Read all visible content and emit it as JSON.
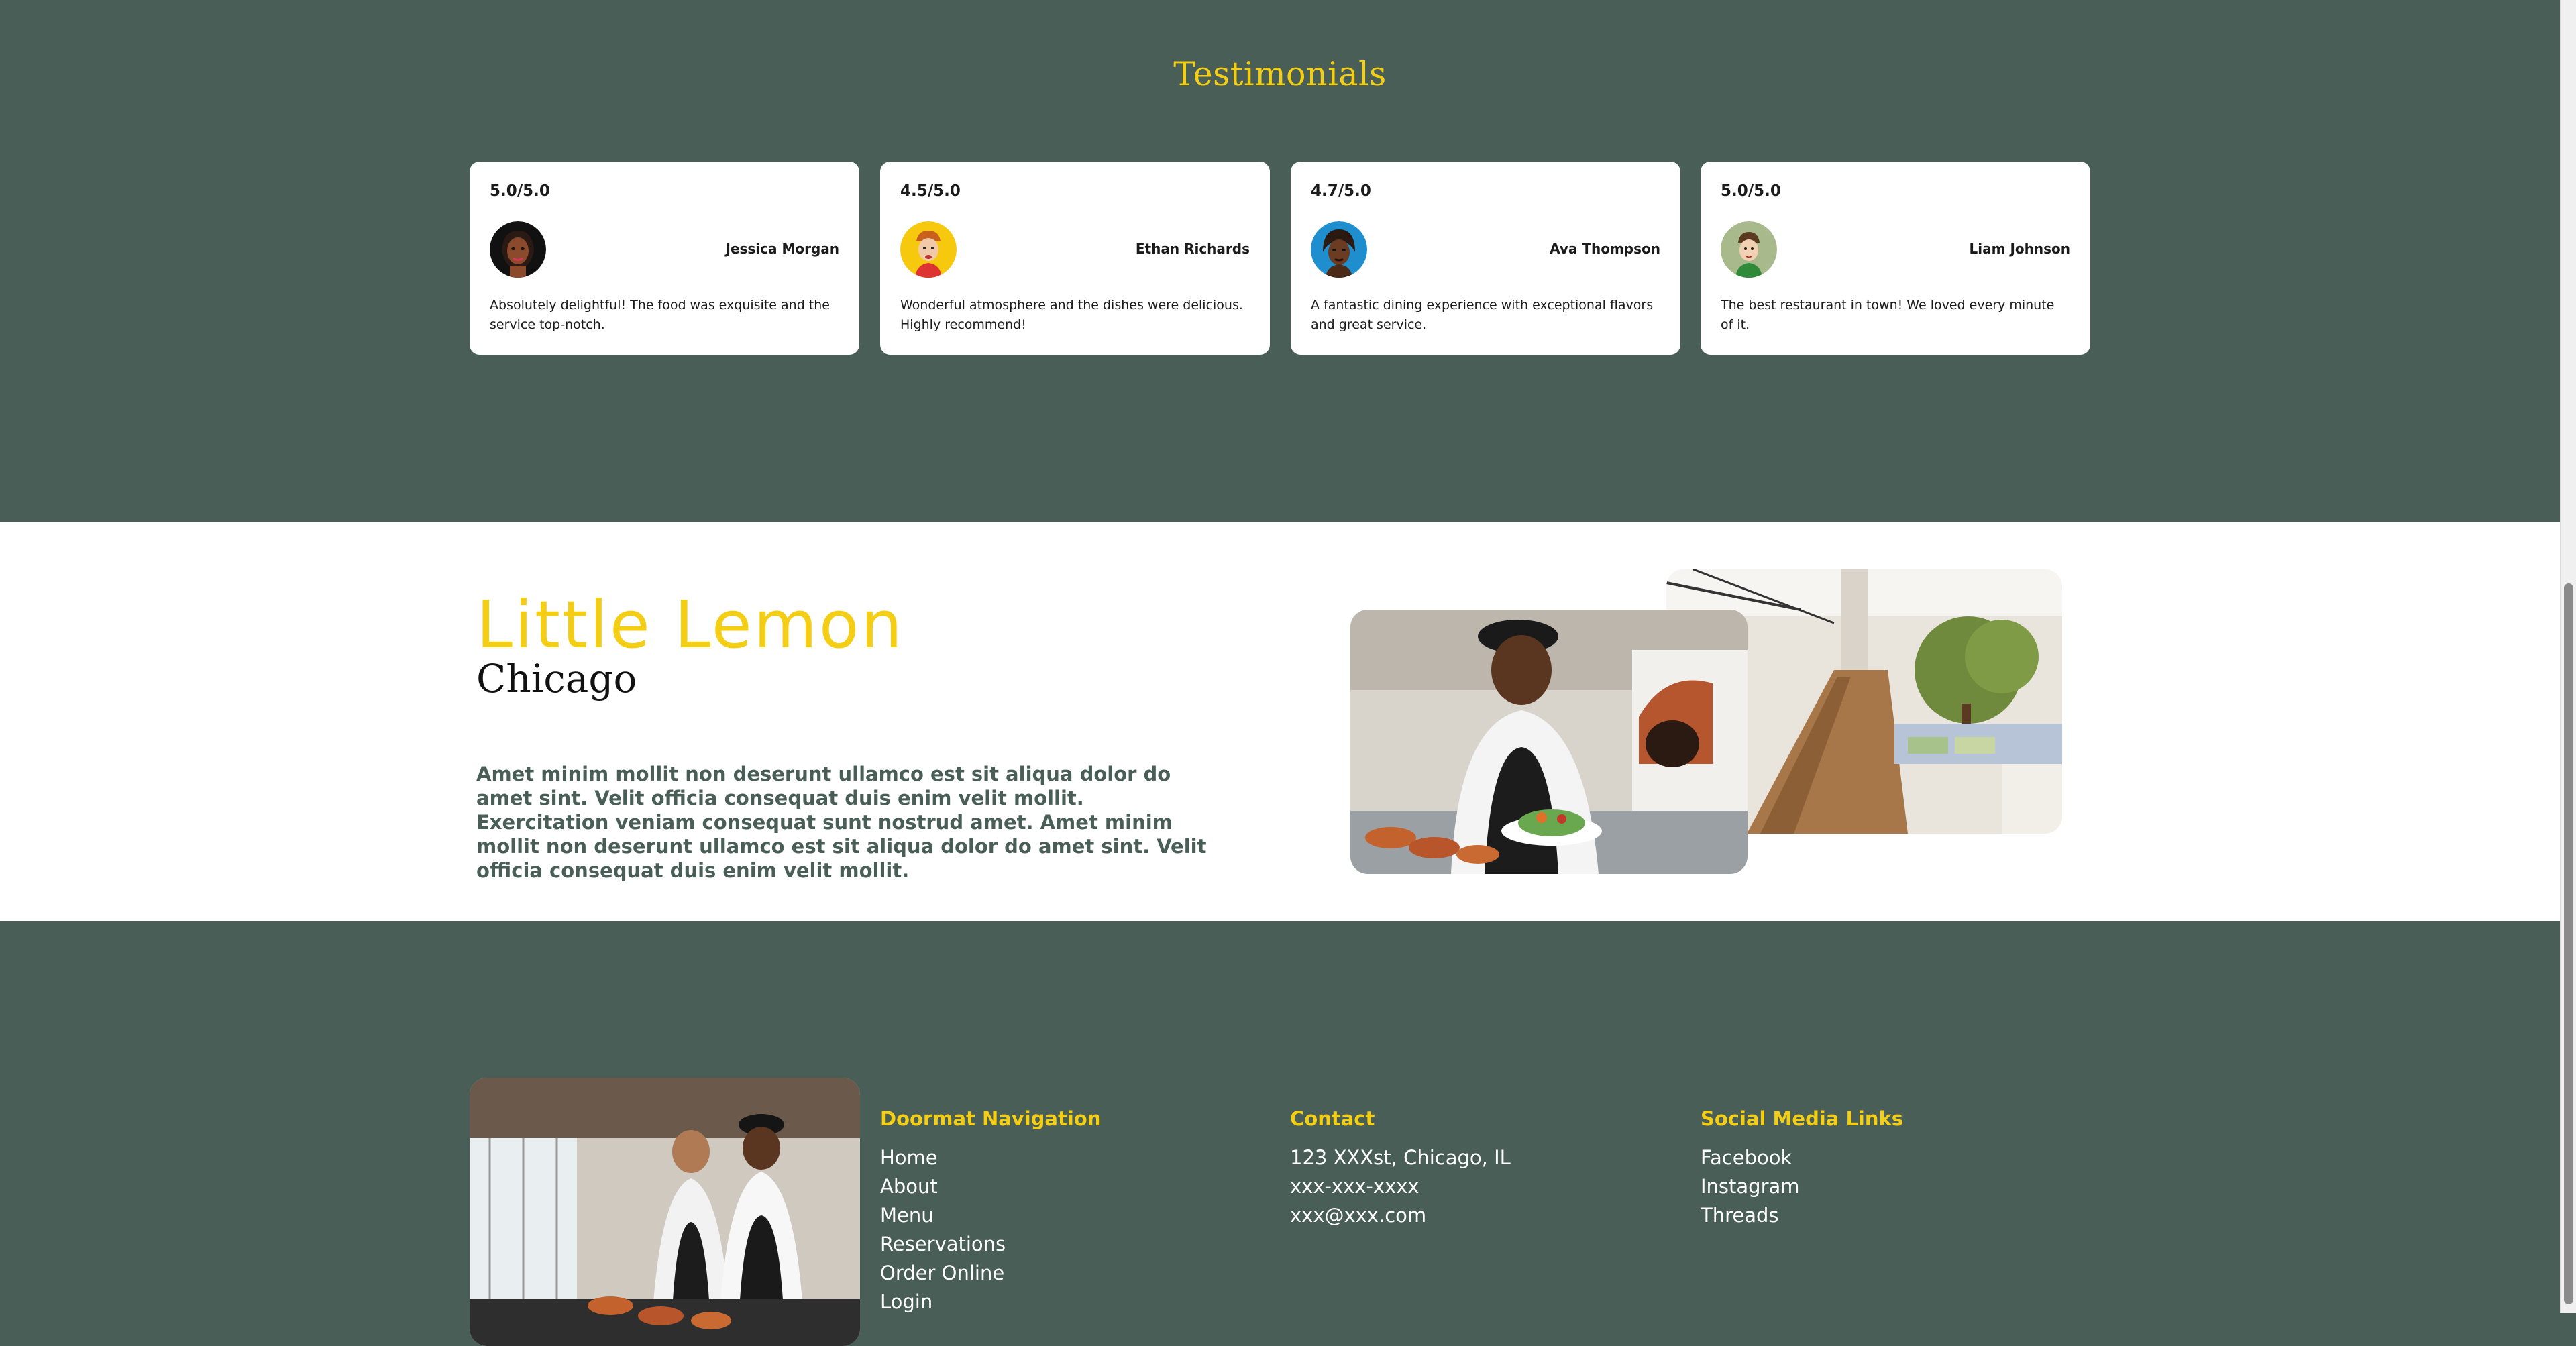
{
  "testimonials": {
    "title": "Testimonials",
    "cards": [
      {
        "rating": "5.0/5.0",
        "name": "Jessica Morgan",
        "quote": "Absolutely delightful! The food was exquisite and the service top-notch.",
        "avatar_icon": "woman-avatar-icon"
      },
      {
        "rating": "4.5/5.0",
        "name": "Ethan Richards",
        "quote": "Wonderful atmosphere and the dishes were delicious. Highly recommend!",
        "avatar_icon": "man-avatar-icon"
      },
      {
        "rating": "4.7/5.0",
        "name": "Ava Thompson",
        "quote": "A fantastic dining experience with exceptional flavors and great service.",
        "avatar_icon": "woman-avatar-icon"
      },
      {
        "rating": "5.0/5.0",
        "name": "Liam Johnson",
        "quote": "The best restaurant in town! We loved every minute of it.",
        "avatar_icon": "man-avatar-icon"
      }
    ]
  },
  "about": {
    "brand": "Little Lemon",
    "city": "Chicago",
    "text": "Amet minim mollit non deserunt ullamco est sit aliqua dolor do amet sint. Velit officia consequat duis enim velit mollit. Exercitation veniam consequat sunt nostrud amet. Amet minim mollit non deserunt ullamco est sit aliqua dolor do amet sint. Velit officia consequat duis enim velit mollit."
  },
  "footer": {
    "navigation": {
      "heading": "Doormat Navigation",
      "links": [
        "Home",
        "About",
        "Menu",
        "Reservations",
        "Order Online",
        "Login"
      ]
    },
    "contact": {
      "heading": "Contact",
      "items": [
        "123 XXXst, Chicago, IL",
        "xxx-xxx-xxxx",
        "xxx@xxx.com"
      ]
    },
    "social": {
      "heading": "Social Media Links",
      "links": [
        "Facebook",
        "Instagram",
        "Threads"
      ]
    }
  },
  "colors": {
    "primary_green": "#495e57",
    "accent_yellow": "#f4ce14",
    "card_white": "#ffffff"
  }
}
